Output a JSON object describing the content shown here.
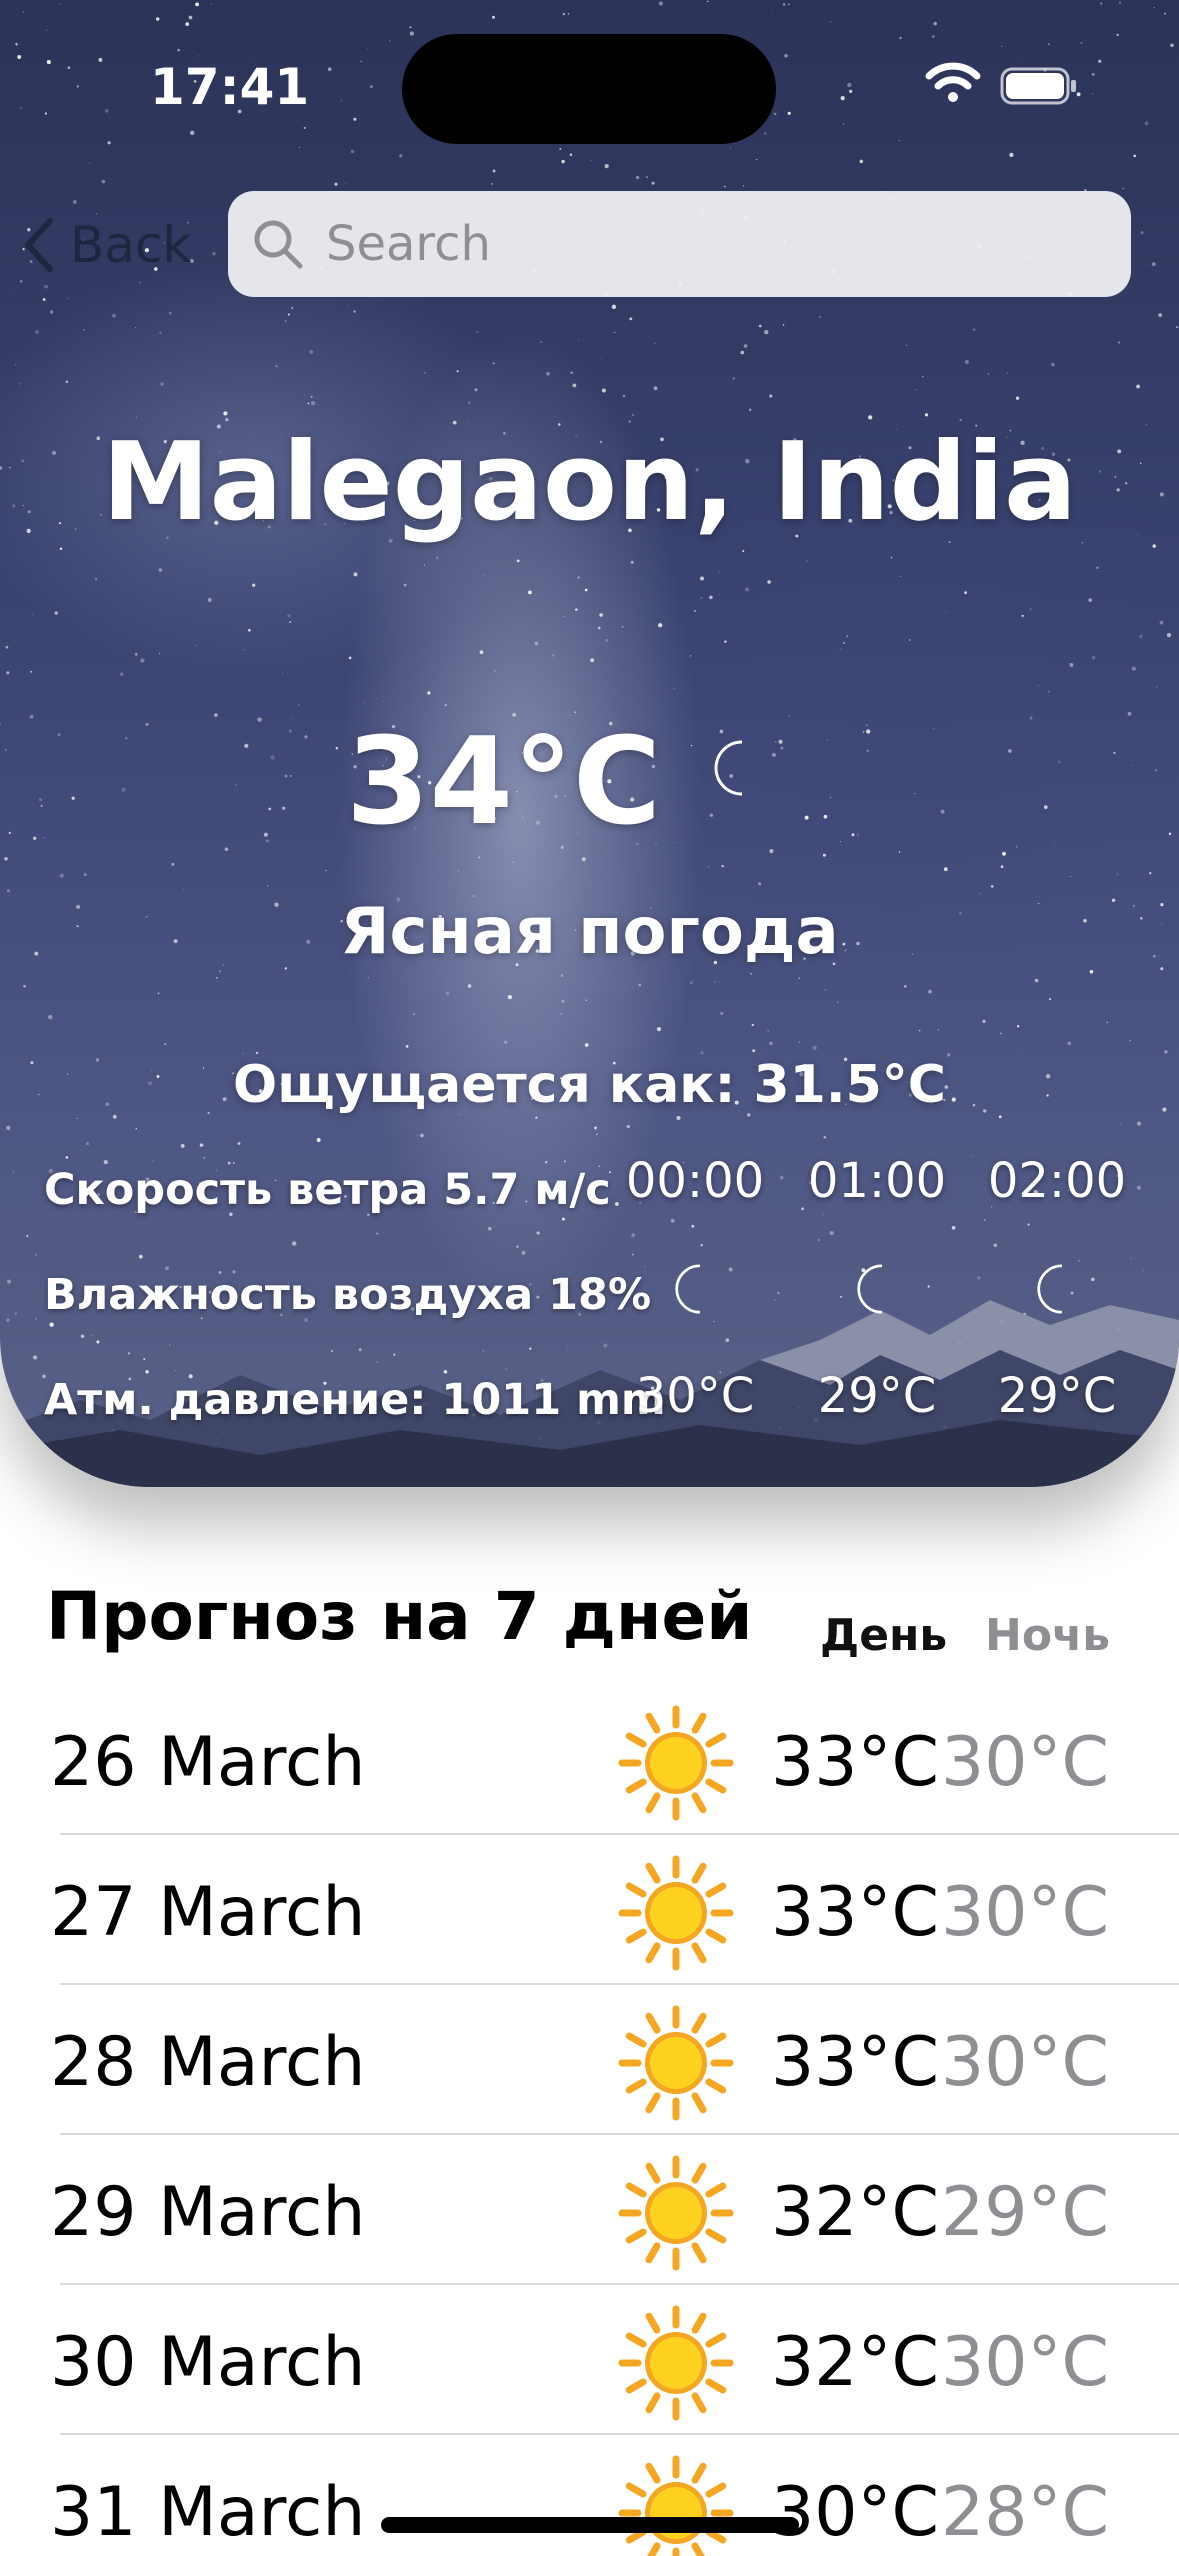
{
  "status_bar": {
    "time": "17:41"
  },
  "nav": {
    "back_label": "Back",
    "search_placeholder": "Search"
  },
  "current": {
    "city": "Malegaon, India",
    "temperature": "34°C",
    "condition": "Ясная погода",
    "feels_like": "Ощущается как: 31.5°C",
    "wind": "Скорость ветра 5.7 м/с",
    "humidity": "Влажность воздуха 18%",
    "pressure": "Атм. давление: 1011 mm",
    "icon": "moon-icon"
  },
  "hourly": [
    {
      "time": "00:00",
      "temp": "30°C",
      "icon": "moon-icon"
    },
    {
      "time": "01:00",
      "temp": "29°C",
      "icon": "moon-icon"
    },
    {
      "time": "02:00",
      "temp": "29°C",
      "icon": "moon-icon"
    }
  ],
  "forecast": {
    "title": "Прогноз на 7 дней",
    "day_label": "День",
    "night_label": "Ночь",
    "days": [
      {
        "date": "26 March",
        "day": "33°C",
        "night": "30°C",
        "icon": "sun-icon"
      },
      {
        "date": "27 March",
        "day": "33°C",
        "night": "30°C",
        "icon": "sun-icon"
      },
      {
        "date": "28 March",
        "day": "33°C",
        "night": "30°C",
        "icon": "sun-icon"
      },
      {
        "date": "29 March",
        "day": "32°C",
        "night": "29°C",
        "icon": "sun-icon"
      },
      {
        "date": "30 March",
        "day": "32°C",
        "night": "30°C",
        "icon": "sun-icon"
      },
      {
        "date": "31 March",
        "day": "30°C",
        "night": "28°C",
        "icon": "sun-icon"
      }
    ]
  },
  "colors": {
    "moon": "#1e6fe0",
    "sun_core": "#ffd21f",
    "sun_rays": "#f5a623",
    "night_text": "#8e8e93"
  }
}
